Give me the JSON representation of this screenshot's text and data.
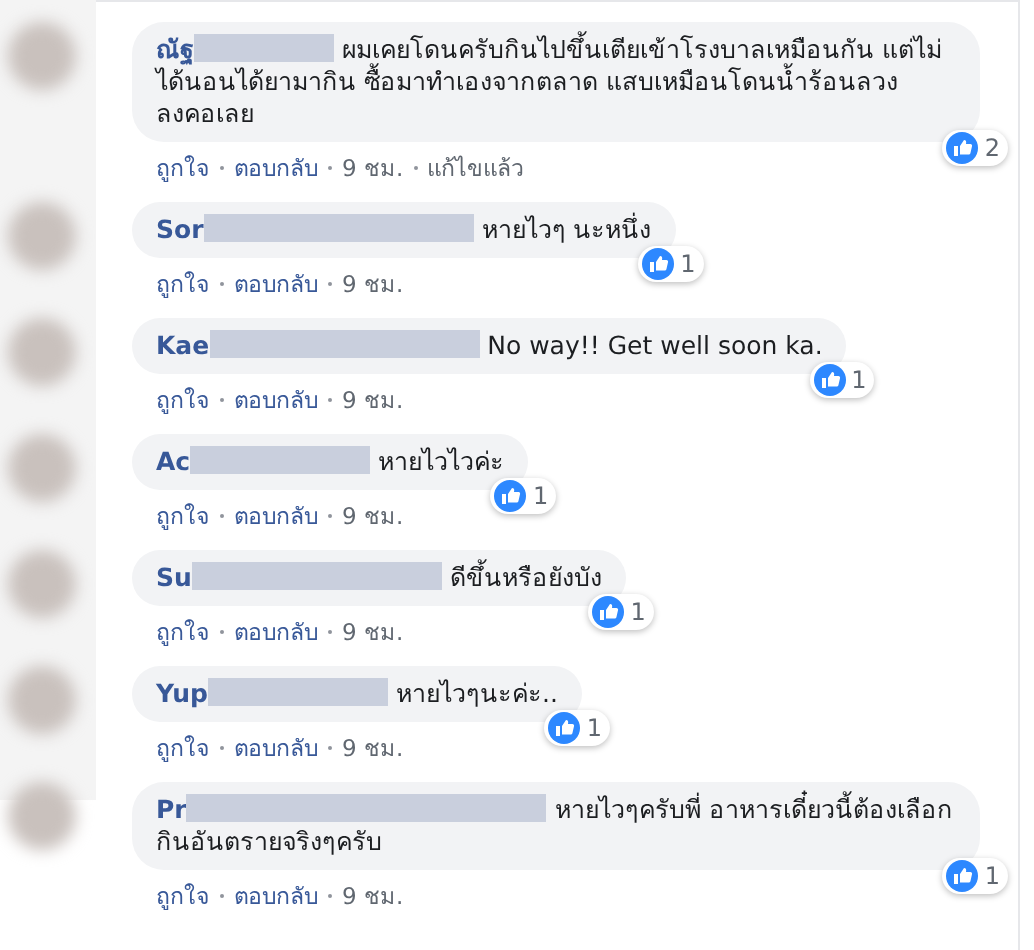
{
  "comments": [
    {
      "name": "ณัฐ",
      "text": "ผมเคยโดนครับกินไปขึ้นเตียเข้าโรงบาลเหมือนกัน แต่ไม่ได้นอนได้ยามากิน ซื้อมาทำเองจากตลาด แสบเหมือนโดนน้ำร้อนลวงลงคอเลย",
      "likes": "2",
      "like_label": "ถูกใจ",
      "reply_label": "ตอบกลับ",
      "time": "9 ชม.",
      "edited": "แก้ไขแล้ว"
    },
    {
      "name": "Sor",
      "text": "หายไวๆ นะหนึ่ง",
      "likes": "1",
      "like_label": "ถูกใจ",
      "reply_label": "ตอบกลับ",
      "time": "9 ชม."
    },
    {
      "name": "Kae",
      "text": "No way!! Get well soon ka.",
      "likes": "1",
      "like_label": "ถูกใจ",
      "reply_label": "ตอบกลับ",
      "time": "9 ชม."
    },
    {
      "name": "Ac",
      "text": "หายไวไวค่ะ",
      "likes": "1",
      "like_label": "ถูกใจ",
      "reply_label": "ตอบกลับ",
      "time": "9 ชม."
    },
    {
      "name": "Su",
      "text": "ดีขึ้นหรือยังบัง",
      "likes": "1",
      "like_label": "ถูกใจ",
      "reply_label": "ตอบกลับ",
      "time": "9 ชม."
    },
    {
      "name": "Yup",
      "text": "หายไวๆนะค่ะ..",
      "likes": "1",
      "like_label": "ถูกใจ",
      "reply_label": "ตอบกลับ",
      "time": "9 ชม."
    },
    {
      "name": "Pr",
      "text": "หายไวๆครับพี่ อาหารเดี๋ยวนี้ต้องเลือกกินอันตรายจริงๆครับ",
      "likes": "1",
      "like_label": "ถูกใจ",
      "reply_label": "ตอบกลับ",
      "time": "9 ชม."
    }
  ]
}
